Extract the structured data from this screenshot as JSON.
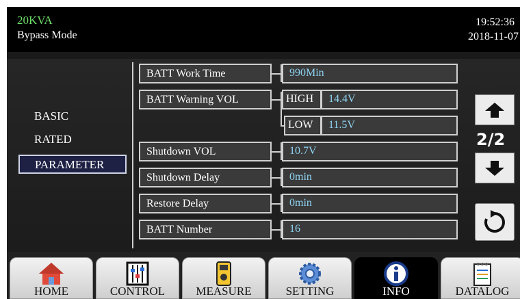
{
  "header": {
    "model": "20KVA",
    "mode": "Bypass Mode",
    "time": "19:52:36",
    "date": "2018-11-07"
  },
  "nav": {
    "basic": "BASIC",
    "rated": "RATED",
    "parameter": "PARAMETER"
  },
  "params": {
    "batt_work_time_label": "BATT Work Time",
    "batt_work_time_value": "990Min",
    "batt_warning_label": "BATT Warning VOL",
    "high_label": "HIGH",
    "high_value": "14.4V",
    "low_label": "LOW",
    "low_value": "11.5V",
    "shutdown_vol_label": "Shutdown VOL",
    "shutdown_vol_value": "10.7V",
    "shutdown_delay_label": "Shutdown Delay",
    "shutdown_delay_value": "0min",
    "restore_delay_label": "Restore Delay",
    "restore_delay_value": "0min",
    "batt_number_label": "BATT Number",
    "batt_number_value": "16"
  },
  "pager": {
    "page": "2/2"
  },
  "tabs": {
    "home": "HOME",
    "control": "CONTROL",
    "measure": "MEASURE",
    "setting": "SETTING",
    "info": "INFO",
    "datalog": "DATALOG"
  },
  "icons": [
    "up-arrow-icon",
    "down-arrow-icon",
    "refresh-icon",
    "home-icon",
    "control-icon",
    "measure-icon",
    "setting-icon",
    "info-icon",
    "datalog-icon"
  ]
}
